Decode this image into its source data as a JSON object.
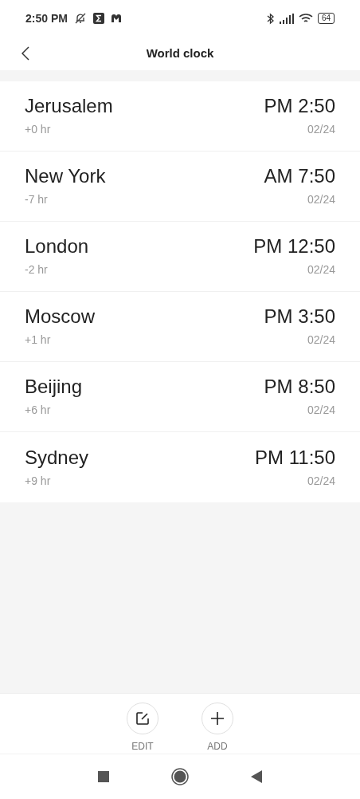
{
  "status_bar": {
    "time": "2:50 PM",
    "battery": "64"
  },
  "header": {
    "title": "World clock"
  },
  "clocks": [
    {
      "city": "Jerusalem",
      "offset": "+0 hr",
      "time": "PM 2:50",
      "date": "02/24"
    },
    {
      "city": "New York",
      "offset": "-7 hr",
      "time": "AM 7:50",
      "date": "02/24"
    },
    {
      "city": "London",
      "offset": "-2 hr",
      "time": "PM 12:50",
      "date": "02/24"
    },
    {
      "city": "Moscow",
      "offset": "+1 hr",
      "time": "PM 3:50",
      "date": "02/24"
    },
    {
      "city": "Beijing",
      "offset": "+6 hr",
      "time": "PM 8:50",
      "date": "02/24"
    },
    {
      "city": "Sydney",
      "offset": "+9 hr",
      "time": "PM 11:50",
      "date": "02/24"
    }
  ],
  "actions": [
    {
      "kind": "edit",
      "label": "EDIT"
    },
    {
      "kind": "add",
      "label": "ADD"
    }
  ]
}
